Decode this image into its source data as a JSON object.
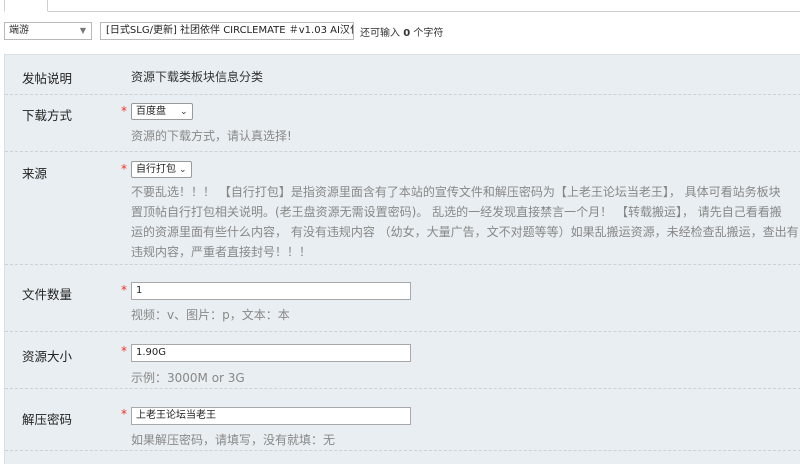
{
  "subject": {
    "type_value": "端游",
    "title_value": "[日式SLG/更新] 社团依伴 CIRCLEMATE ＃v1.03 AI汉化",
    "remain_prefix": "还可输入",
    "remain_count": "0",
    "remain_suffix": "个字符"
  },
  "form": {
    "intro": {
      "label": "发帖说明",
      "text": "资源下载类板块信息分类"
    },
    "download": {
      "label": "下载方式",
      "value": "百度盘",
      "help": "资源的下载方式，请认真选择!"
    },
    "source": {
      "label": "来源",
      "value": "自行打包",
      "help_lines": [
        "不要乱选！！！ 【自行打包】是指资源里面含有了本站的宣传文件和解压密码为【上老王论坛当老王】， 具体可看站务板块",
        "置顶帖自行打包相关说明。(老王盘资源无需设置密码)。 乱选的一经发现直接禁言一个月！ 【转载搬运】， 请先自己看看搬",
        "运的资源里面有些什么内容， 有没有违规内容 （幼女，大量广告，文不对题等等）如果乱搬运资源，未经检查乱搬运，查出有",
        "违规内容，严重者直接封号！！！"
      ]
    },
    "file_count": {
      "label": "文件数量",
      "value": "1",
      "help": "视频：v、图片：p，文本：本"
    },
    "size": {
      "label": "资源大小",
      "value": "1.90G",
      "help": "示例：3000M or 3G"
    },
    "password": {
      "label": "解压密码",
      "value": "上老王论坛当老王",
      "help": "如果解压密码，请填写，没有就填：无"
    }
  },
  "colors": {
    "panel_bg": "#e8eef2",
    "required_star": "#ee3322",
    "help_text": "#888888"
  },
  "icons": {
    "select_arrow": "chevron-down-icon"
  }
}
